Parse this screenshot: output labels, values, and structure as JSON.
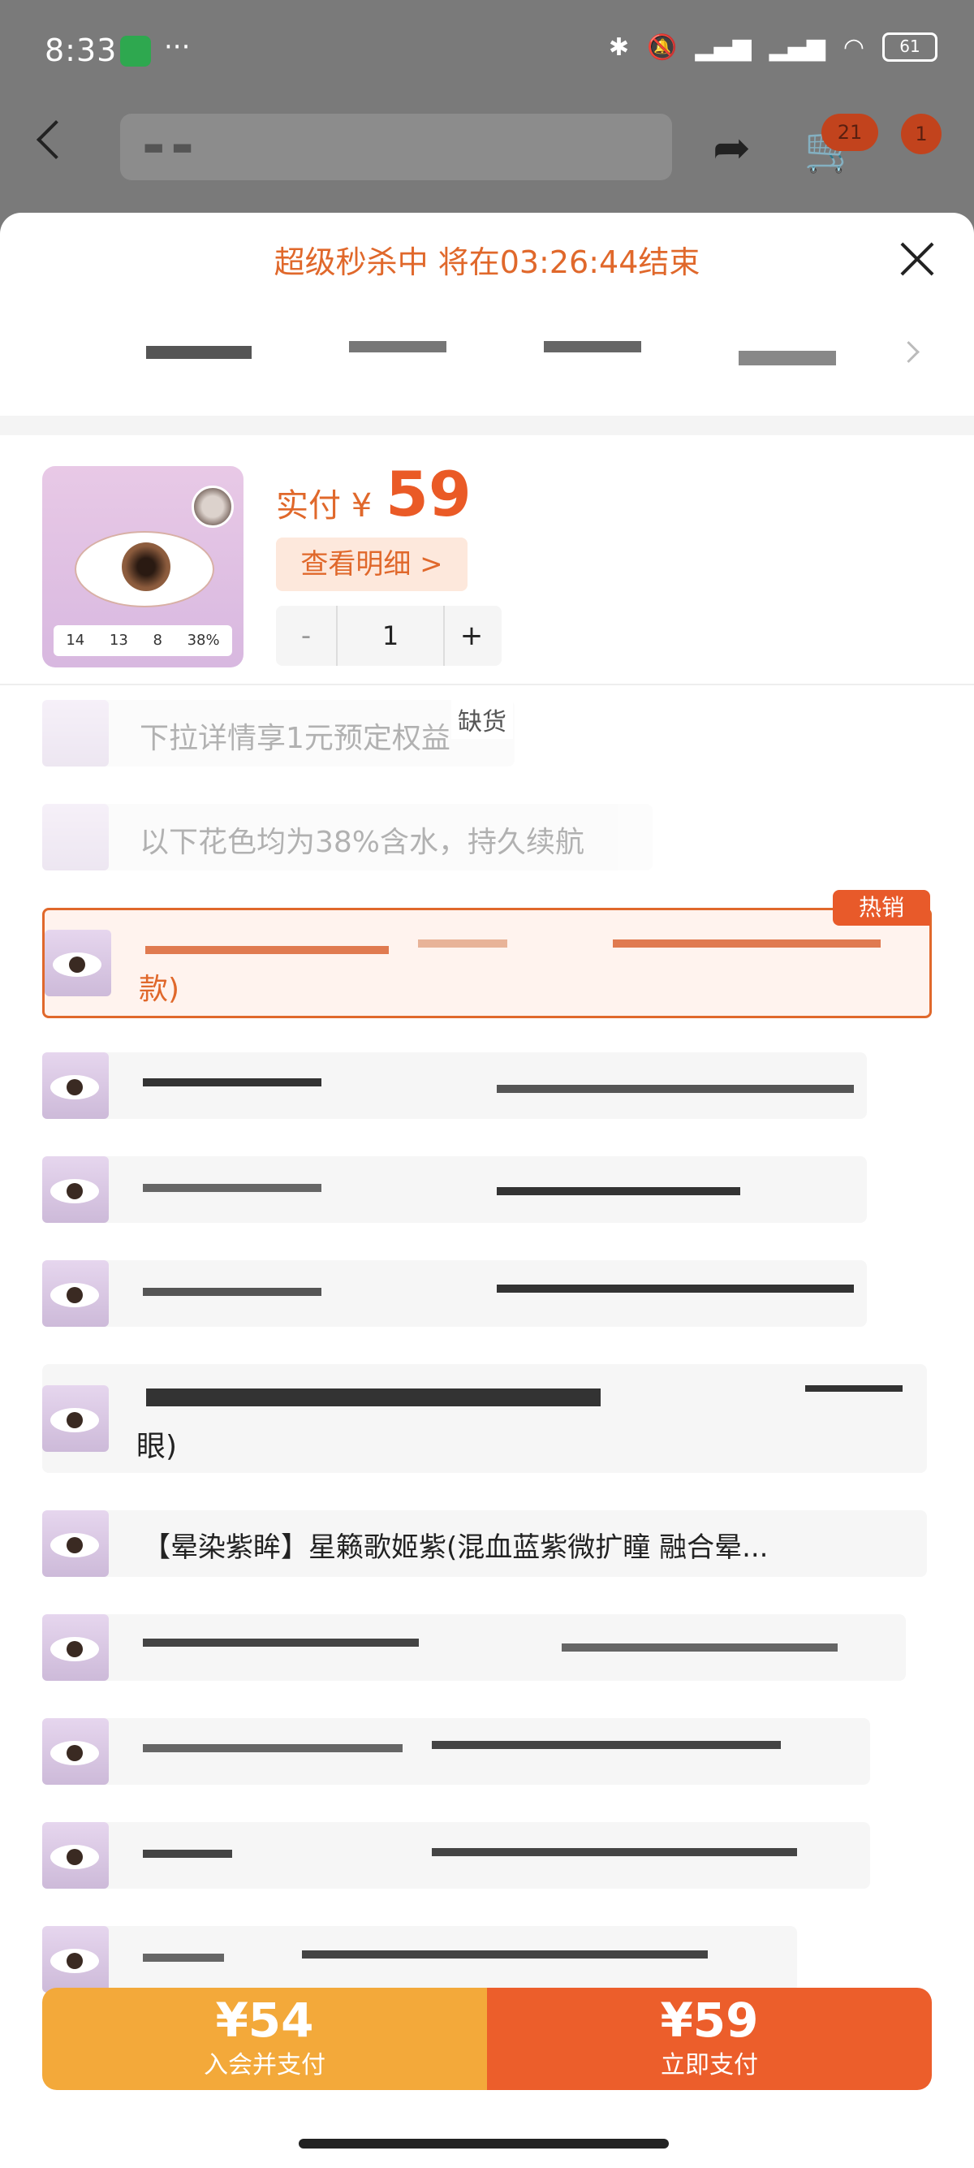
{
  "status_bar": {
    "time": "8:33",
    "more": "···",
    "battery": "61"
  },
  "nav": {
    "cart_count": "21",
    "msg_count": "1"
  },
  "flash_sale": "超级秒杀中 将在03:26:44结束",
  "product": {
    "pay_label": "实付 ¥",
    "pay_price": "59",
    "detail_button": "查看明细 >",
    "quantity": "1",
    "minus": "-",
    "plus": "+",
    "stats": [
      "14",
      "13",
      "8",
      "38%"
    ]
  },
  "options": {
    "out_of_stock": "缺货",
    "promo_1": "下拉详情享1元预定权益",
    "promo_2": "以下花色均为38%含水，持久续航",
    "selected_suffix": "款)",
    "hot_badge": "热销",
    "opt_5_suffix": "眼)",
    "opt_6": "【晕染紫眸】星籁歌姬紫(混血蓝紫微扩瞳 融合晕..."
  },
  "bottom": {
    "member_price": "¥54",
    "member_label": "入会并支付",
    "pay_price": "¥59",
    "pay_label": "立即支付"
  }
}
